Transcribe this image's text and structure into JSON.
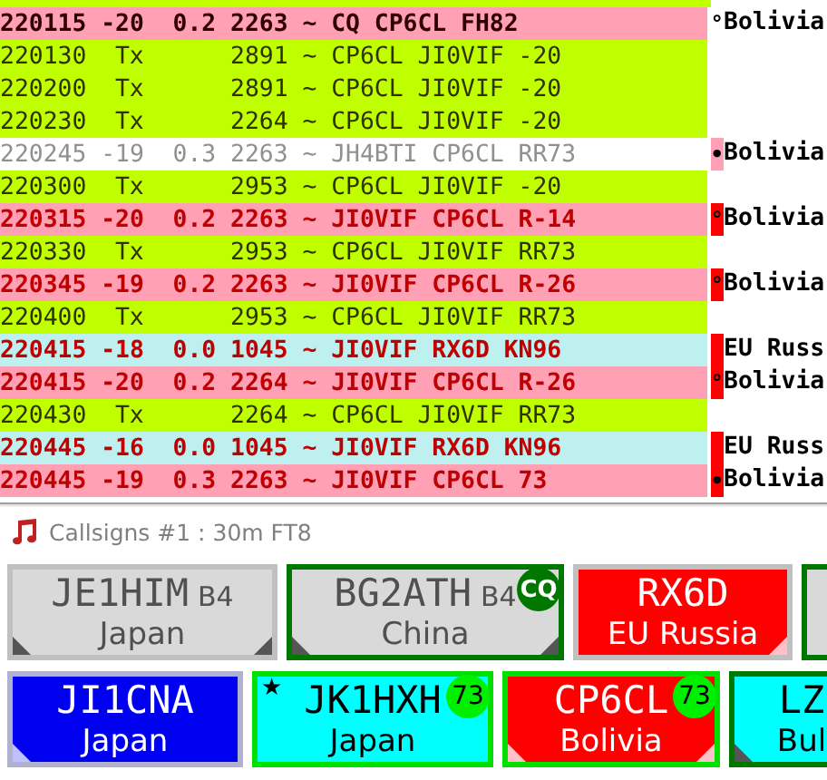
{
  "decodes": [
    {
      "time": "220115",
      "snr": "-20",
      "dt": "0.2",
      "freq": "2263",
      "message": "~ CQ CP6CL FH82",
      "kind": "cq",
      "marker": "°",
      "country": "Bolivia"
    },
    {
      "time": "220130",
      "snr": "Tx",
      "freq": "2891",
      "message": "~ CP6CL JI0VIF -20",
      "kind": "tx"
    },
    {
      "time": "220200",
      "snr": "Tx",
      "freq": "2891",
      "message": "~ CP6CL JI0VIF -20",
      "kind": "tx"
    },
    {
      "time": "220230",
      "snr": "Tx",
      "freq": "2264",
      "message": "~ CP6CL JI0VIF -20",
      "kind": "tx"
    },
    {
      "time": "220245",
      "snr": "-19",
      "dt": "0.3",
      "freq": "2263",
      "message": "~ JH4BTI CP6CL RR73",
      "kind": "other",
      "marker": "•",
      "country": "Bolivia",
      "color": "#ffa0b4"
    },
    {
      "time": "220300",
      "snr": "Tx",
      "freq": "2953",
      "message": "~ CP6CL JI0VIF -20",
      "kind": "tx"
    },
    {
      "time": "220315",
      "snr": "-20",
      "dt": "0.2",
      "freq": "2263",
      "message": "~ JI0VIF CP6CL R-14",
      "kind": "to_me",
      "marker": "°",
      "country": "Bolivia",
      "color": "#ff0000"
    },
    {
      "time": "220330",
      "snr": "Tx",
      "freq": "2953",
      "message": "~ CP6CL JI0VIF RR73",
      "kind": "tx"
    },
    {
      "time": "220345",
      "snr": "-19",
      "dt": "0.2",
      "freq": "2263",
      "message": "~ JI0VIF CP6CL R-26",
      "kind": "to_me",
      "marker": "°",
      "country": "Bolivia",
      "color": "#ff0000"
    },
    {
      "time": "220400",
      "snr": "Tx",
      "freq": "2953",
      "message": "~ CP6CL JI0VIF RR73",
      "kind": "tx"
    },
    {
      "time": "220415",
      "snr": "-18",
      "dt": "0.0",
      "freq": "1045",
      "message": "~ JI0VIF RX6D KN96",
      "kind": "to_me_other",
      "country": "EU Russ",
      "color": "#ff0000"
    },
    {
      "time": "220415",
      "snr": "-20",
      "dt": "0.2",
      "freq": "2264",
      "message": "~ JI0VIF CP6CL R-26",
      "kind": "to_me",
      "marker": "°",
      "country": "Bolivia",
      "color": "#ff0000"
    },
    {
      "time": "220430",
      "snr": "Tx",
      "freq": "2264",
      "message": "~ CP6CL JI0VIF RR73",
      "kind": "tx"
    },
    {
      "time": "220445",
      "snr": "-16",
      "dt": "0.0",
      "freq": "1045",
      "message": "~ JI0VIF RX6D KN96",
      "kind": "to_me_other",
      "country": "EU Russ",
      "color": "#ff0000"
    },
    {
      "time": "220445",
      "snr": "-19",
      "dt": "0.3",
      "freq": "2263",
      "message": "~ JI0VIF CP6CL 73",
      "kind": "to_me",
      "marker": "•",
      "country": "Bolivia",
      "color": "#ff0000"
    }
  ],
  "callsigns_panel": {
    "title": "Callsigns #1 : 30m FT8",
    "rows": [
      [
        {
          "callsign": "JE1HIM",
          "suffix": "B4",
          "country": "Japan",
          "color": "#d9d9d9",
          "kind": "plain",
          "corner_left": true,
          "corner_right": true
        },
        {
          "callsign": "BG2ATH",
          "suffix": "B4",
          "country": "China",
          "color": "#d9d9d9",
          "kind": "active",
          "badge": "CQ",
          "corner_left": true,
          "corner_right": true
        },
        {
          "callsign": "RX6D",
          "country": "EU Russia",
          "color": "#ff0000",
          "kind": "plain",
          "corner_left": false,
          "corner_right": true
        },
        {
          "color": "#d9d9d9",
          "kind": "active",
          "corner_left": false,
          "corner_right": false
        }
      ],
      [
        {
          "callsign": "JI1CNA",
          "country": "Japan",
          "color": "#0000f0",
          "kind": "own",
          "corner_left": true,
          "corner_right": false
        },
        {
          "callsign": "JK1HXH",
          "country": "Japan",
          "color": "#00ffff",
          "kind": "worked",
          "badge": "73",
          "star": "★",
          "corner_left": false,
          "corner_right": false
        },
        {
          "callsign": "CP6CL",
          "country": "Bolivia",
          "color": "#ff0000",
          "kind": "worked",
          "badge": "73",
          "corner_left": true,
          "corner_right": true
        },
        {
          "callsign": "LZ",
          "country": "Bul",
          "color": "#00ffff",
          "kind": "active",
          "corner_left": true,
          "corner_right": false
        }
      ]
    ]
  }
}
